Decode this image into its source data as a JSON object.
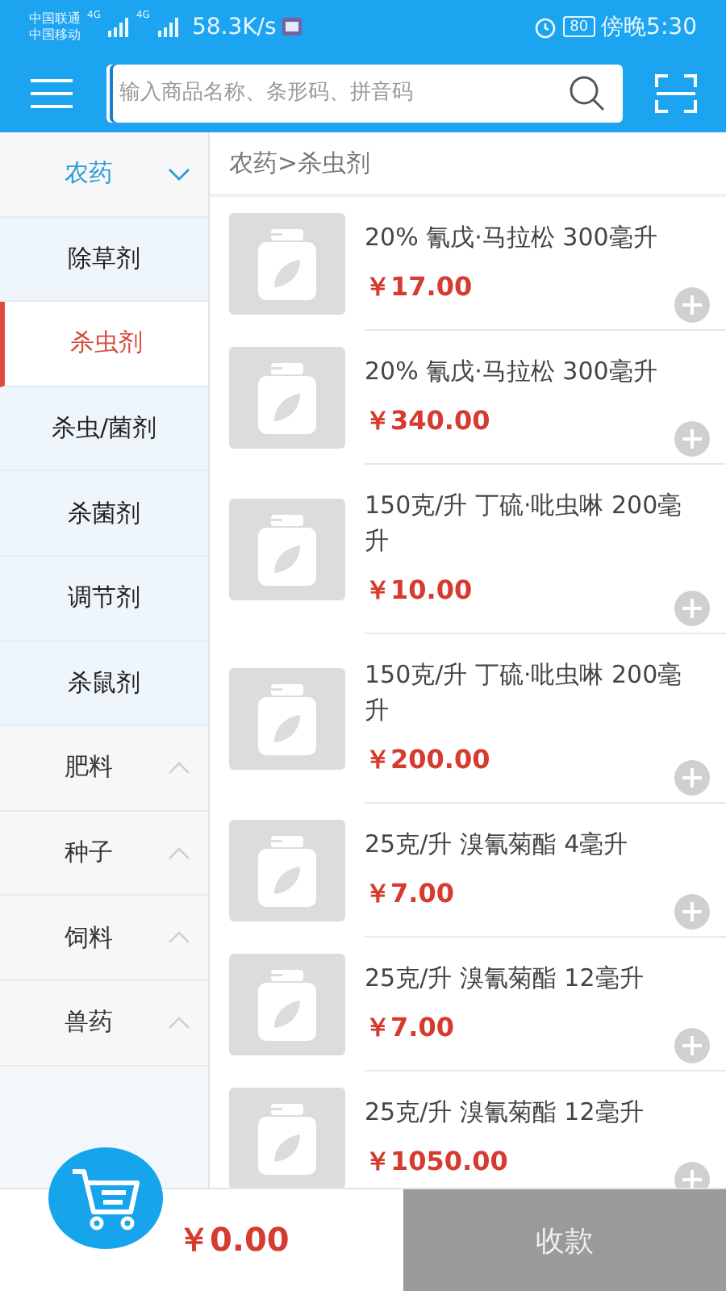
{
  "status_bar": {
    "carriers": [
      "中国联通",
      "中国移动"
    ],
    "network_labels": [
      "4G",
      "4G"
    ],
    "speed": "58.3K/s",
    "battery": "80",
    "time": "傍晚5:30"
  },
  "header": {
    "search": {
      "placeholder": "输入商品名称、条形码、拼音码"
    }
  },
  "sidebar": {
    "categories": [
      {
        "label": "农药",
        "expanded": true,
        "children": [
          {
            "label": "除草剂",
            "selected": false
          },
          {
            "label": "杀虫剂",
            "selected": true
          },
          {
            "label": "杀虫/菌剂",
            "selected": false
          },
          {
            "label": "杀菌剂",
            "selected": false
          },
          {
            "label": "调节剂",
            "selected": false
          },
          {
            "label": "杀鼠剂",
            "selected": false
          }
        ]
      },
      {
        "label": "肥料",
        "expanded": false
      },
      {
        "label": "种子",
        "expanded": false
      },
      {
        "label": "饲料",
        "expanded": false
      },
      {
        "label": "兽药",
        "expanded": false
      }
    ]
  },
  "breadcrumb": "农药>杀虫剂",
  "products": [
    {
      "name": "20% 氰戊·马拉松 300毫升",
      "price": "￥17.00"
    },
    {
      "name": "20% 氰戊·马拉松 300毫升",
      "price": "￥340.00"
    },
    {
      "name": "150克/升 丁硫·吡虫啉 200毫升",
      "price": "￥10.00"
    },
    {
      "name": "150克/升 丁硫·吡虫啉 200毫升",
      "price": "￥200.00"
    },
    {
      "name": "25克/升 溴氰菊酯 4毫升",
      "price": "￥7.00"
    },
    {
      "name": "25克/升 溴氰菊酯 12毫升",
      "price": "￥7.00"
    },
    {
      "name": "25克/升 溴氰菊酯 12毫升",
      "price": "￥1050.00"
    }
  ],
  "cart": {
    "total": "￥0.00",
    "checkout": "收款"
  }
}
